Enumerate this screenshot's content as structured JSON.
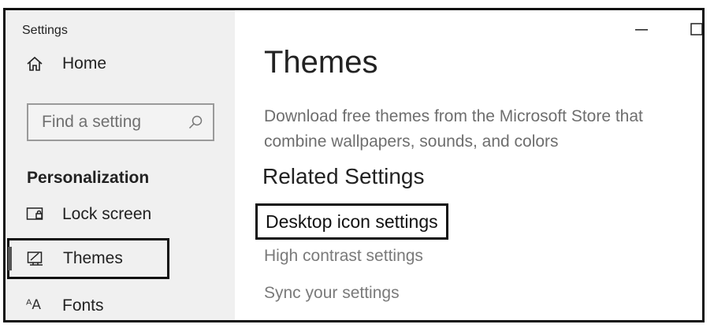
{
  "app": {
    "title": "Settings"
  },
  "sidebar": {
    "home_label": "Home",
    "search": {
      "placeholder": "Find a setting"
    },
    "section_title": "Personalization",
    "items": [
      {
        "label": "Lock screen",
        "icon": "lock-screen-icon"
      },
      {
        "label": "Themes",
        "icon": "themes-icon",
        "selected": true
      },
      {
        "label": "Fonts",
        "icon": "fonts-icon",
        "glyph": "ᴬA"
      }
    ]
  },
  "main": {
    "title": "Themes",
    "description": "Download free themes from the Microsoft Store that combine wallpapers, sounds, and colors",
    "related_title": "Related Settings",
    "links": [
      {
        "label": "Desktop icon settings",
        "highlighted": true
      },
      {
        "label": "High contrast settings"
      },
      {
        "label": "Sync your settings"
      }
    ]
  },
  "window_controls": {
    "minimize_icon": "minimize-icon",
    "maximize_icon": "maximize-icon"
  },
  "colors": {
    "sidebar_bg": "#f0f0f0",
    "main_bg": "#ffffff",
    "link_gray": "#7a7a7a",
    "border": "#111111"
  }
}
